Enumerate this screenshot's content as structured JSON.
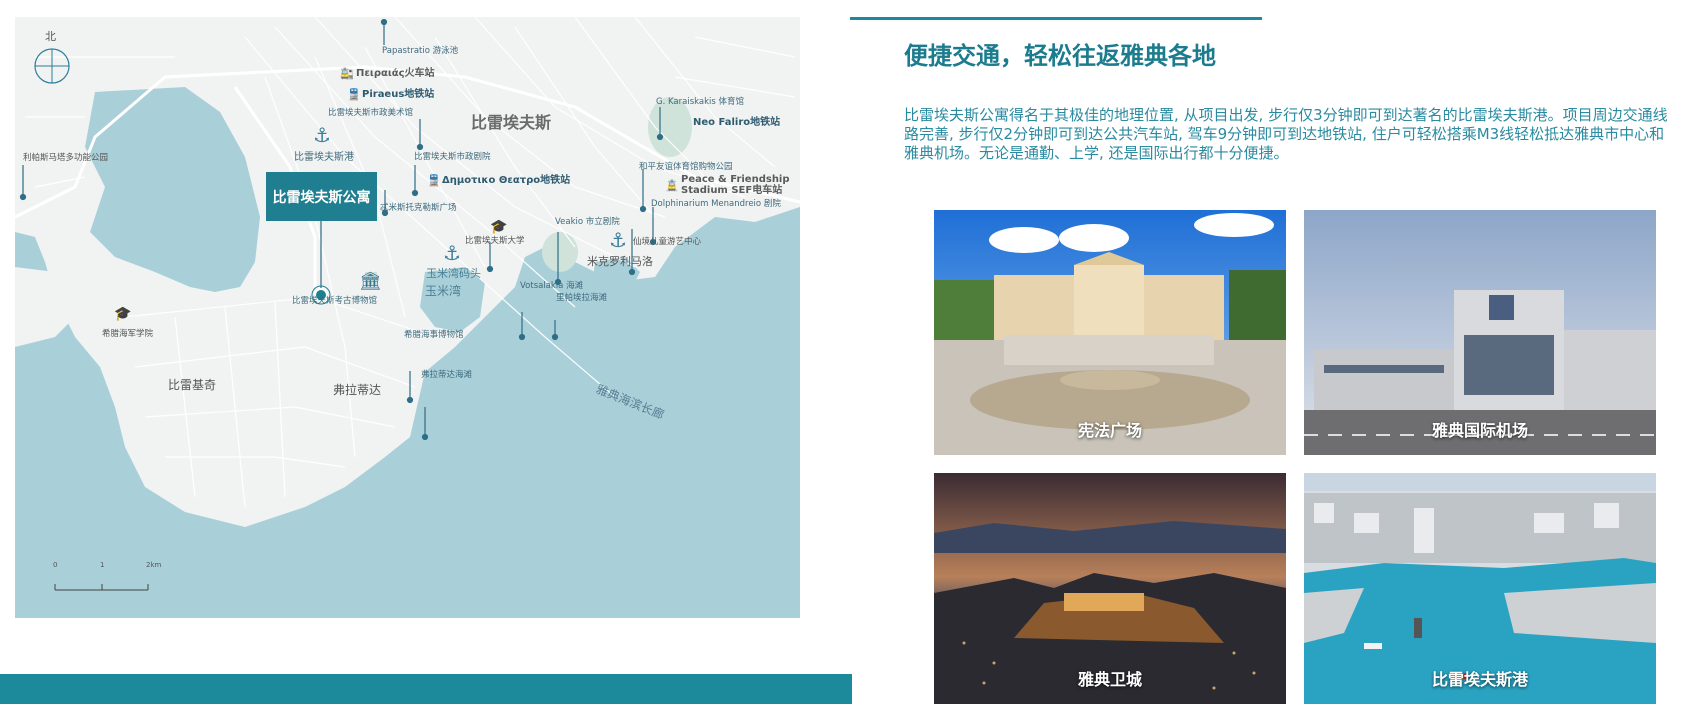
{
  "map": {
    "compass": "北",
    "apartment_label": "比雷埃夫斯公寓",
    "district": "比雷埃夫斯",
    "labels": {
      "papastratio": "Papastratio 游泳池",
      "piraeus_train": "Πειραιάς火车站",
      "piraeus_metro": "Piraeus地铁站",
      "municipal_art": "比雷埃夫斯市政美术馆",
      "piraeus_port": "比雷埃夫斯港",
      "leipsios": "利帕斯马塔多功能公园",
      "municipal_theatre": "比雷埃夫斯市政剧院",
      "dimotiko_station": "Δημοτικο Θεατρο地铁站",
      "karaiskakis": "G. Karaiskakis 体育馆",
      "neo_faliro": "Neo Faliro地铁站",
      "peace_park": "和平友谊体育馆购物公园",
      "peace_stadium_1": "Peace & Friendship",
      "peace_stadium_2": "Stadium SEF电车站",
      "dolphinarium": "Dolphinarium Menandreio 剧院",
      "themistokleous": "忒米斯托克勒斯广场",
      "university": "比雷埃夫斯大学",
      "veakio": "Veakio 市立剧院",
      "fairytale": "仙境儿童游艺中心",
      "mikrolimano": "米克罗利马洛",
      "zea_marina": "玉米湾码头",
      "zea_bay": "玉米湾",
      "votsalakia": "Votsalakia 海滩",
      "lipa": "里帕埃拉海滩",
      "archaeo_museum": "比雷埃夫斯考古博物馆",
      "naval_academy": "希腊海军学院",
      "maritime_museum": "希腊海事博物馆",
      "freatida": "弗拉蒂达海滩",
      "piraiki": "比雷基奇",
      "freattyda": "弗拉蒂达",
      "coast": "雅典海滨长廊"
    },
    "scale": {
      "zero": "0",
      "one": "1",
      "two": "2km"
    }
  },
  "content": {
    "title": "便捷交通，轻松往返雅典各地",
    "description": "比雷埃夫斯公寓得名于其极佳的地理位置, 从项目出发, 步行仅3分钟即可到达著名的比雷埃夫斯港。项目周边交通线路完善, 步行仅2分钟即可到达公共汽车站, 驾车9分钟即可到达地铁站, 住户可轻松搭乘M3线轻松抵达雅典市中心和雅典机场。无论是通勤、上学, 还是国际出行都十分便捷。"
  },
  "photos": [
    {
      "caption": "宪法广场"
    },
    {
      "caption": "雅典国际机场"
    },
    {
      "caption": "雅典卫城"
    },
    {
      "caption": "比雷埃夫斯港"
    }
  ],
  "colors": {
    "accent": "#1d8a9b",
    "title": "#1c7c8e",
    "sea": "#a9cfd9",
    "land": "#f1f2f2"
  }
}
